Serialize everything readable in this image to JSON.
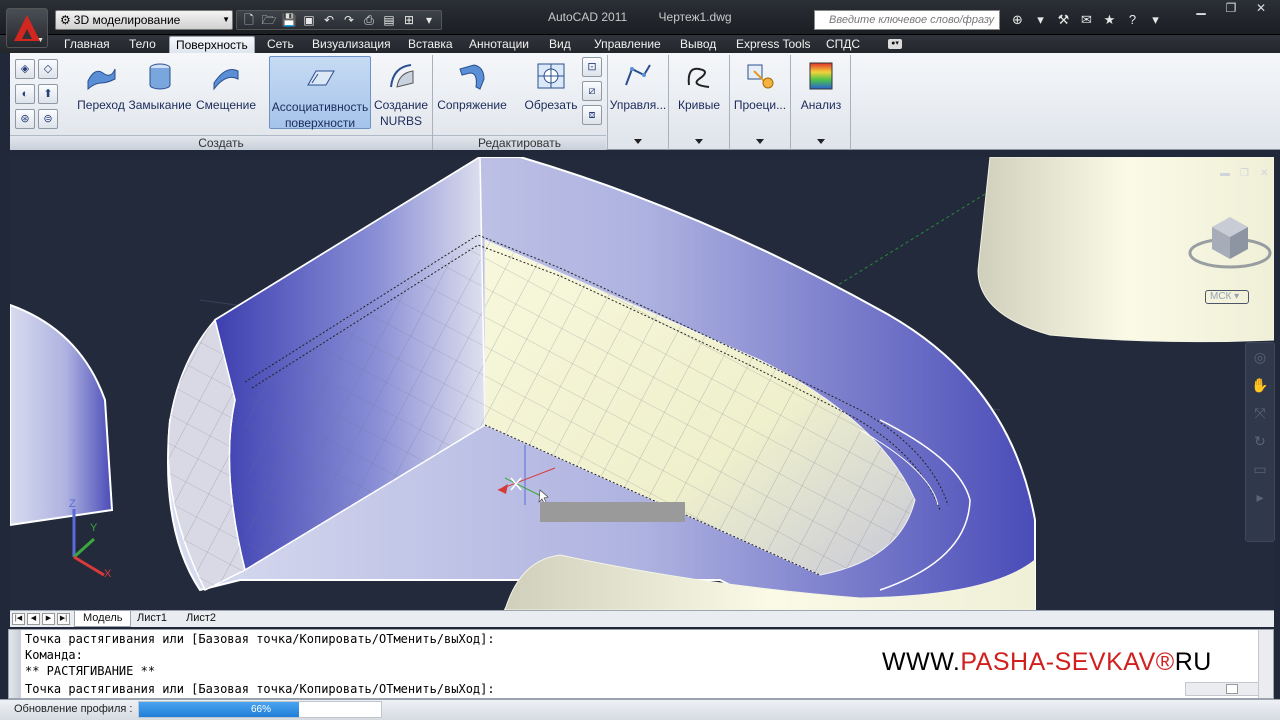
{
  "app": {
    "title": "AutoCAD 2011",
    "document": "Чертеж1.dwg",
    "workspace": "3D моделирование",
    "search_placeholder": "Введите ключевое слово/фразу",
    "brand_color": "#d2261f"
  },
  "ribbon_tabs": [
    "Главная",
    "Тело",
    "Поверхность",
    "Сеть",
    "Визуализация",
    "Вставка",
    "Аннотации",
    "Вид",
    "Управление",
    "Вывод",
    "Express Tools",
    "СПДС"
  ],
  "active_tab": "Поверхность",
  "ribbon": {
    "create": {
      "label": "Создать",
      "buttons": [
        "Переход",
        "Замыкание",
        "Смещение"
      ],
      "assoc_line1": "Ассоциативность",
      "assoc_line2": "поверхности",
      "nurbs_line1": "Создание",
      "nurbs_line2": "NURBS"
    },
    "edit": {
      "label": "Редактировать",
      "buttons": [
        "Сопряжение",
        "Обрезать"
      ]
    },
    "dropdowns": [
      "Управля...",
      "Кривые",
      "Проеци...",
      "Анализ"
    ]
  },
  "viewport": {
    "ucs_label": "МСК",
    "axes": {
      "x": "X",
      "y": "Y",
      "z": "Z"
    }
  },
  "layout_tabs": [
    "Модель",
    "Лист1",
    "Лист2"
  ],
  "command": {
    "lines": [
      "Точка растягивания или [Базовая точка/Копировать/ОТменить/выХод]:",
      "Команда:",
      "** РАСТЯГИВАНИЕ **",
      "Точка растягивания или [Базовая точка/Копировать/ОТменить/выХод]:"
    ]
  },
  "watermark": {
    "prefix": "WWW.",
    "name": "PASHA-SEVKAV",
    "mark": "®",
    "suffix": "RU"
  },
  "status": {
    "text": "Обновление профиля :",
    "progress_percent": 66,
    "progress_label": "66%"
  }
}
